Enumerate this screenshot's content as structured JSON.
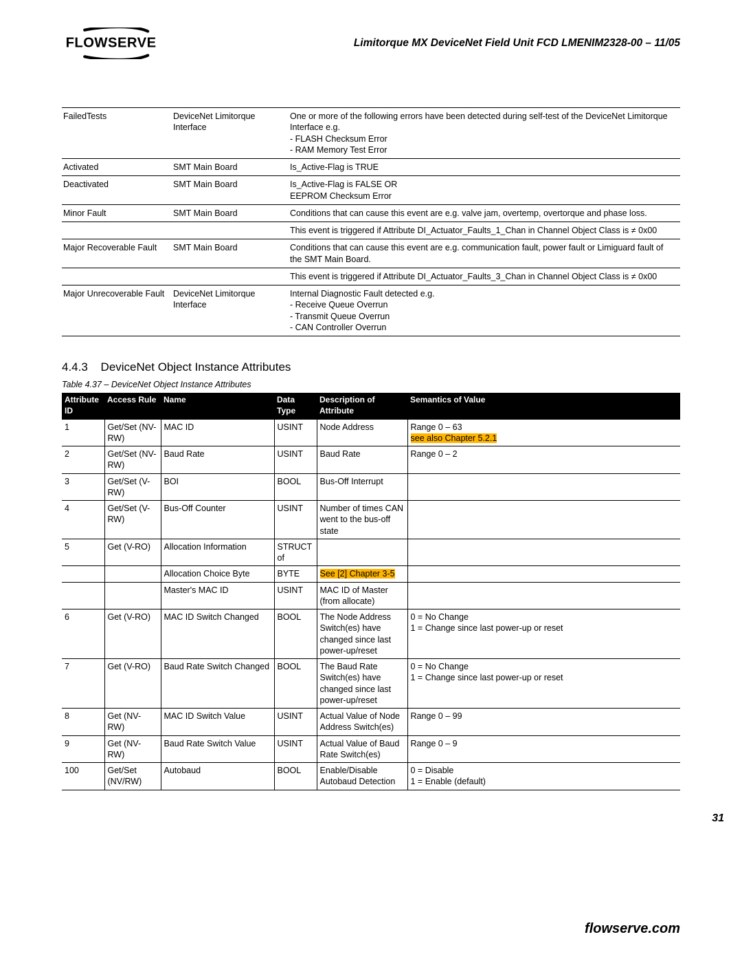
{
  "header": {
    "logo_text": "FLOWSERVE",
    "title": "Limitorque MX DeviceNet Field Unit   FCD LMENIM2328-00 – 11/05"
  },
  "events_table": {
    "rows": [
      {
        "name": "FailedTests",
        "source": "DeviceNet Limitorque Interface",
        "desc": "One or more of the following errors have been detected during self-test of the DeviceNet Limitorque Interface e.g.\n- FLASH Checksum Error\n- RAM Memory Test Error"
      },
      {
        "name": "Activated",
        "source": "SMT Main Board",
        "desc": "Is_Active-Flag is TRUE"
      },
      {
        "name": "Deactivated",
        "source": "SMT Main Board",
        "desc": "Is_Active-Flag is FALSE OR\nEEPROM Checksum Error"
      },
      {
        "name": "Minor Fault",
        "source": "SMT Main Board",
        "desc": "Conditions that can cause this event are e.g. valve jam, overtemp, overtorque and phase loss.",
        "extra": "This event is triggered if Attribute DI_Actuator_Faults_1_Chan in Channel Object Class is ≠ 0x00"
      },
      {
        "name": "Major Recoverable Fault",
        "source": "SMT Main Board",
        "desc": "Conditions that can cause this event are e.g. communication fault, power fault or Limiguard fault of the SMT Main Board.",
        "extra": "This event is triggered if Attribute DI_Actuator_Faults_3_Chan in Channel Object Class is ≠ 0x00"
      },
      {
        "name": "Major Unrecoverable Fault",
        "source": "DeviceNet Limitorque Interface",
        "desc": "Internal Diagnostic Fault detected e.g.\n- Receive Queue Overrun\n- Transmit Queue Overrun\n- CAN Controller Overrun"
      }
    ]
  },
  "section": {
    "number": "4.4.3",
    "title": "DeviceNet Object Instance Attributes",
    "caption": "Table 4.37 – DeviceNet Object Instance Attributes"
  },
  "attr_headers": {
    "c1": "Attribute ID",
    "c2": "Access Rule",
    "c3": "Name",
    "c4": "Data Type",
    "c5": "Description of Attribute",
    "c6": "Semantics of Value"
  },
  "attr_rows": [
    {
      "id": "1",
      "rule": "Get/Set (NV-RW)",
      "name": "MAC ID",
      "type": "USINT",
      "desc": "Node Address",
      "sem": "Range 0 – 63\n",
      "sem_hl": "see also Chapter 5.2.1"
    },
    {
      "id": "2",
      "rule": "Get/Set (NV-RW)",
      "name": "Baud Rate",
      "type": "USINT",
      "desc": "Baud Rate",
      "sem": "Range 0 – 2"
    },
    {
      "id": "3",
      "rule": "Get/Set (V-RW)",
      "name": "BOI",
      "type": "BOOL",
      "desc": "Bus-Off Interrupt",
      "sem": ""
    },
    {
      "id": "4",
      "rule": "Get/Set (V-RW)",
      "name": "Bus-Off Counter",
      "type": "USINT",
      "desc": "Number of times CAN went to the bus-off state",
      "sem": ""
    },
    {
      "id": "5",
      "rule": "Get (V-RO)",
      "name": "Allocation Information",
      "type": "STRUCT of",
      "desc": "",
      "sem": "",
      "subs": [
        {
          "name": "Allocation Choice Byte",
          "type": "BYTE",
          "desc_hl": "See [2] Chapter 3-5",
          "sem": ""
        },
        {
          "name": "Master's MAC ID",
          "type": "USINT",
          "desc": "MAC ID of Master (from allocate)",
          "sem": ""
        }
      ]
    },
    {
      "id": "6",
      "rule": "Get (V-RO)",
      "name": "MAC ID Switch Changed",
      "type": "BOOL",
      "desc": "The Node Address Switch(es) have changed since last power-up/reset",
      "sem": "0 = No Change\n1 = Change since last power-up or reset"
    },
    {
      "id": "7",
      "rule": "Get (V-RO)",
      "name": "Baud Rate Switch Changed",
      "type": "BOOL",
      "desc": "The Baud Rate Switch(es) have changed since last power-up/reset",
      "sem": "0 = No Change\n1 = Change since last power-up or reset"
    },
    {
      "id": "8",
      "rule": "Get (NV-RW)",
      "name": "MAC ID Switch Value",
      "type": "USINT",
      "desc": "Actual Value of Node Address Switch(es)",
      "sem": "Range 0 – 99"
    },
    {
      "id": "9",
      "rule": "Get (NV-RW)",
      "name": "Baud Rate Switch Value",
      "type": "USINT",
      "desc": "Actual Value of Baud Rate Switch(es)",
      "sem": "Range 0 – 9"
    },
    {
      "id": "100",
      "rule": "Get/Set (NV/RW)",
      "name": "Autobaud",
      "type": "BOOL",
      "desc": "Enable/Disable Autobaud Detection",
      "sem": "0 = Disable\n1 = Enable (default)"
    }
  ],
  "page_number": "31",
  "footer": "flowserve.com"
}
